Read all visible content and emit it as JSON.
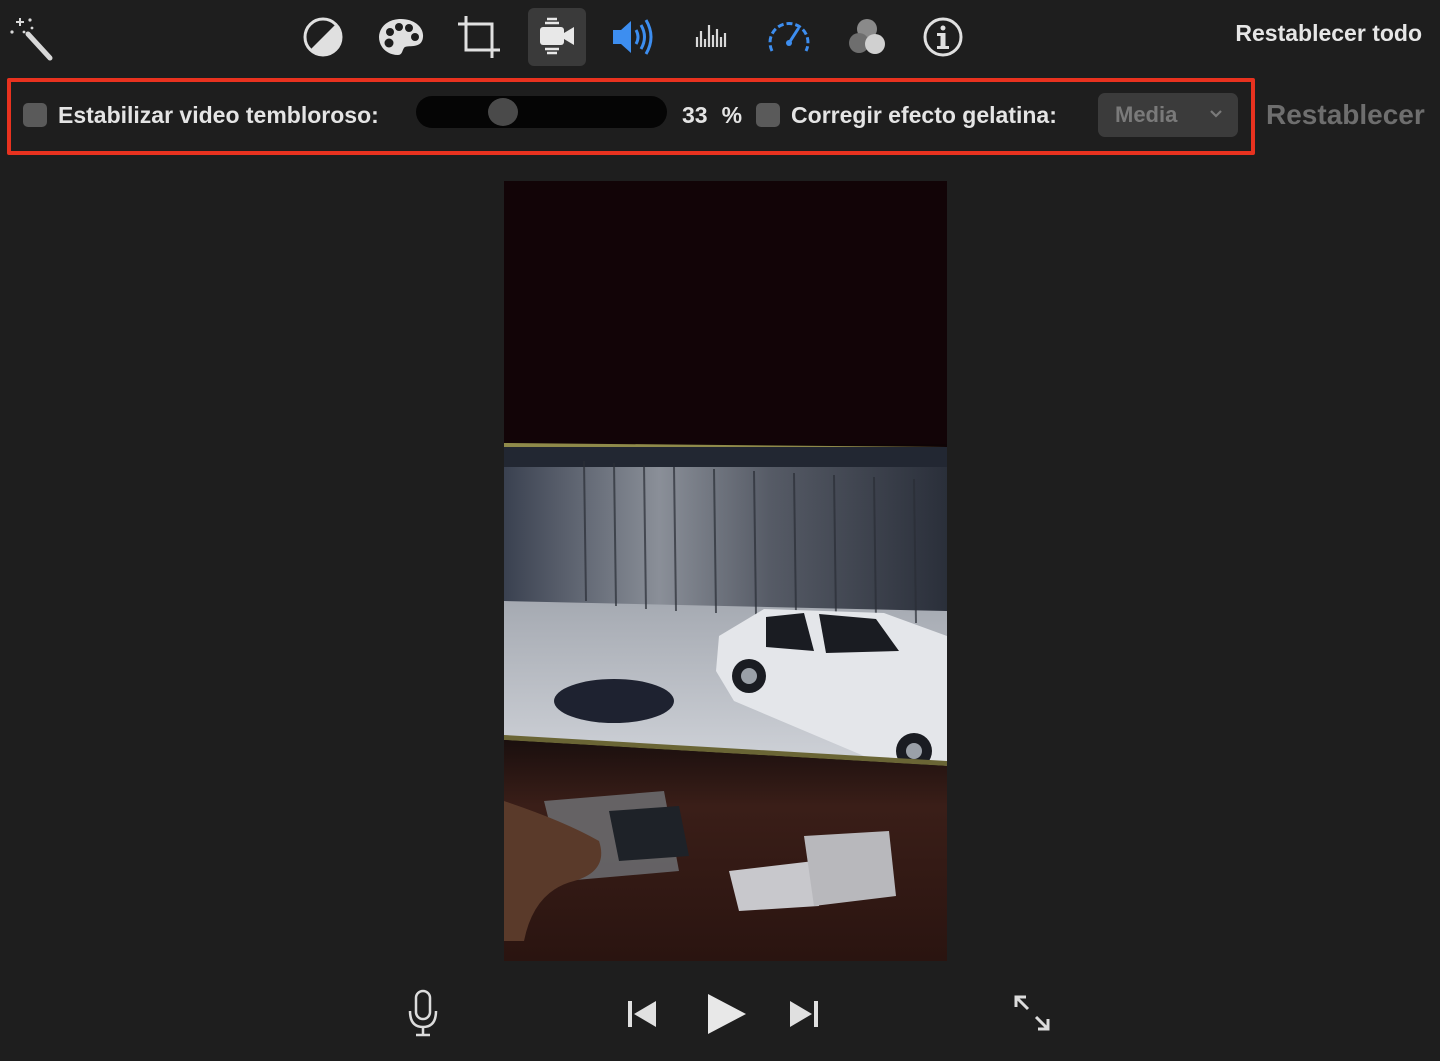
{
  "toolbar": {
    "reset_all_label": "Restablecer todo",
    "tools": [
      {
        "icon": "magic-wand-icon"
      },
      {
        "icon": "color-balance-icon"
      },
      {
        "icon": "palette-icon"
      },
      {
        "icon": "crop-icon"
      },
      {
        "icon": "stabilization-camera-icon",
        "selected": true
      },
      {
        "icon": "volume-icon"
      },
      {
        "icon": "equalizer-icon"
      },
      {
        "icon": "speed-icon"
      },
      {
        "icon": "filters-icon"
      },
      {
        "icon": "info-icon"
      }
    ]
  },
  "stabilization": {
    "stabilize_label": "Estabilizar video tembloroso:",
    "stabilize_checked": false,
    "percent_value": "33",
    "percent_sign": "%",
    "rolling_shutter_label": "Corregir efecto gelatina:",
    "rolling_shutter_checked": false,
    "rolling_shutter_selected": "Media",
    "reset_label": "Restablecer"
  },
  "colors": {
    "accent_blue": "#3d8ef0",
    "highlight_red": "#e8321f",
    "background": "#1e1e1e"
  },
  "transport": {
    "buttons": [
      "microphone-icon",
      "skip-back-icon",
      "play-icon",
      "skip-forward-icon",
      "fullscreen-icon"
    ]
  }
}
